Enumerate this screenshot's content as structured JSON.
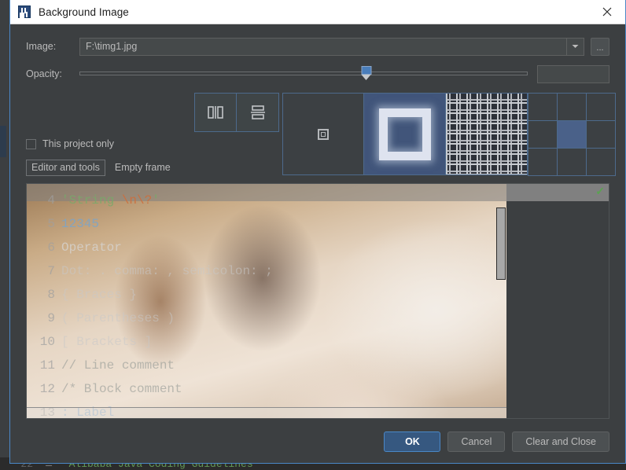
{
  "ide": {
    "editor_line_number": "22",
    "editor_fold_icon": "fold-marker",
    "editor_text": "* Alibaba Java Coding Guidelines"
  },
  "dialog": {
    "title": "Background Image",
    "app_icon": "intellij-idea-icon",
    "close_icon": "close-icon"
  },
  "form": {
    "image_label": "Image:",
    "image_path": "F:\\timg1.jpg",
    "image_placeholder": "",
    "dropdown_icon": "chevron-down-icon",
    "browse_label": "...",
    "opacity_label": "Opacity:",
    "opacity_value": "64",
    "opacity_percent": 64,
    "stepper_up_icon": "chevron-up-icon",
    "stepper_down_icon": "chevron-down-icon"
  },
  "placement": {
    "mirror_horizontal_icon": "mirror-horizontal-icon",
    "mirror_vertical_icon": "mirror-vertical-icon",
    "fill_modes": [
      {
        "name": "center",
        "icon": "center-square-icon",
        "selected": false
      },
      {
        "name": "scaled",
        "icon": "scaled-square-icon",
        "selected": true
      },
      {
        "name": "tiled",
        "icon": "tiled-pattern-icon",
        "selected": false
      }
    ],
    "anchor_grid": {
      "name": "anchor-position-grid",
      "cells": [
        "top-left",
        "top-center",
        "top-right",
        "middle-left",
        "middle-center",
        "middle-right",
        "bottom-left",
        "bottom-center",
        "bottom-right"
      ],
      "selected": "middle-center"
    }
  },
  "options": {
    "project_only_label": "This project only",
    "project_only_checked": false,
    "scope_selected": "Editor and tools",
    "frame_type_label": "Empty frame"
  },
  "preview": {
    "green_check_icon": "valid-check-icon",
    "vertical_scrollbar": "preview-vertical-scrollbar",
    "horizontal_scrollbar": "preview-horizontal-scrollbar",
    "code_lines": [
      {
        "num": "4",
        "segments": [
          {
            "text": "'String ",
            "cls": "tok-str"
          },
          {
            "text": "\\n\\?",
            "cls": "tok-esc"
          },
          {
            "text": "'",
            "cls": "tok-str"
          }
        ]
      },
      {
        "num": "5",
        "segments": [
          {
            "text": "12345",
            "cls": "tok-num"
          }
        ]
      },
      {
        "num": "6",
        "segments": [
          {
            "text": "Operator",
            "cls": "tok-plain"
          }
        ]
      },
      {
        "num": "7",
        "segments": [
          {
            "text": "Dot: . comma: , semicolon: ;",
            "cls": "tok-dim"
          }
        ]
      },
      {
        "num": "8",
        "segments": [
          {
            "text": "{ Braces }",
            "cls": "tok-dim"
          }
        ]
      },
      {
        "num": "9",
        "segments": [
          {
            "text": "( Parentheses )",
            "cls": "tok-dim"
          }
        ]
      },
      {
        "num": "10",
        "segments": [
          {
            "text": "[ Brackets ]",
            "cls": "tok-dim"
          }
        ]
      },
      {
        "num": "11",
        "segments": [
          {
            "text": "// Line comment",
            "cls": "tok-cmt"
          }
        ]
      },
      {
        "num": "12",
        "segments": [
          {
            "text": "/* Block comment",
            "cls": "tok-cmt"
          }
        ]
      },
      {
        "num": "13",
        "segments": [
          {
            "text": ": Label",
            "cls": "tok-lbl"
          }
        ]
      }
    ]
  },
  "footer": {
    "ok_label": "OK",
    "cancel_label": "Cancel",
    "clear_label": "Clear and Close"
  },
  "colors": {
    "accent": "#365880",
    "accent_border": "#4a88c7",
    "panel": "#3c3f41",
    "field": "#45494a",
    "text": "#bbbbbb",
    "selected_tile": "#41557a",
    "check_green": "#5aa350"
  }
}
